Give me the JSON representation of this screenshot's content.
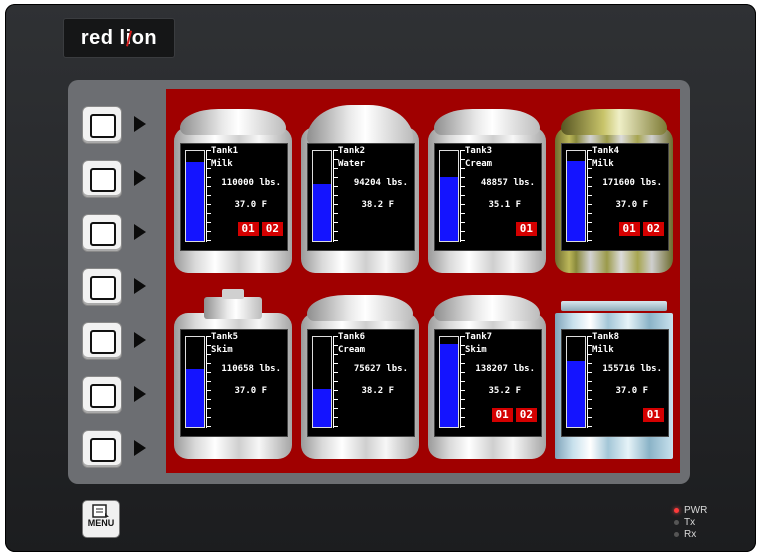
{
  "brand": {
    "logo_text": "red lion"
  },
  "keys": {
    "count": 7,
    "menu_label": "MENU"
  },
  "tanks": [
    {
      "name": "Tank1",
      "product": "Milk",
      "weight": "110000 lbs.",
      "temp": "37.0 F",
      "level": 0.88,
      "codes": [
        "01",
        "02"
      ]
    },
    {
      "name": "Tank2",
      "product": "Water",
      "weight": "94204 lbs.",
      "temp": "38.2 F",
      "level": 0.63,
      "codes": []
    },
    {
      "name": "Tank3",
      "product": "Cream",
      "weight": "48857 lbs.",
      "temp": "35.1 F",
      "level": 0.71,
      "codes": [
        "01"
      ]
    },
    {
      "name": "Tank4",
      "product": "Milk",
      "weight": "171600 lbs.",
      "temp": "37.0 F",
      "level": 0.89,
      "codes": [
        "01",
        "02"
      ]
    },
    {
      "name": "Tank5",
      "product": "Skim",
      "weight": "110658 lbs.",
      "temp": "37.0 F",
      "level": 0.64,
      "codes": []
    },
    {
      "name": "Tank6",
      "product": "Cream",
      "weight": "75627 lbs.",
      "temp": "38.2 F",
      "level": 0.42,
      "codes": []
    },
    {
      "name": "Tank7",
      "product": "Skim",
      "weight": "138207 lbs.",
      "temp": "35.2 F",
      "level": 0.92,
      "codes": [
        "01",
        "02"
      ]
    },
    {
      "name": "Tank8",
      "product": "Milk",
      "weight": "155716 lbs.",
      "temp": "37.0 F",
      "level": 0.73,
      "codes": [
        "01"
      ]
    }
  ],
  "status": {
    "pwr": "PWR",
    "tx": "Tx",
    "rx": "Rx",
    "pwr_on": true,
    "tx_on": false,
    "rx_on": false
  },
  "colors": {
    "screen_bg": "#a00000",
    "gauge_fill": "#1414ff",
    "code_bg": "#d40000",
    "led_on": "#ff3a3a"
  }
}
